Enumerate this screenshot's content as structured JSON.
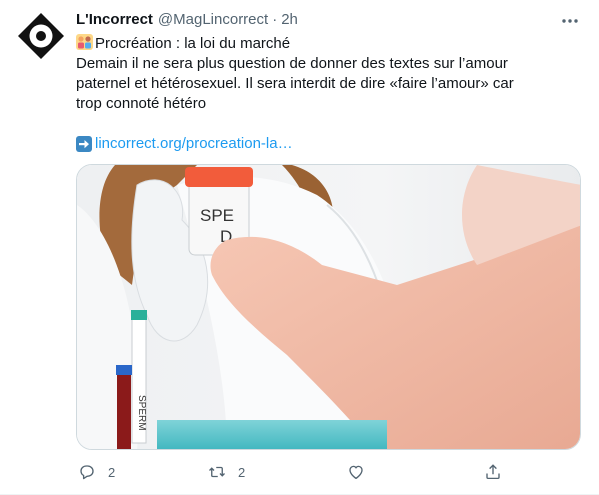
{
  "tweet": {
    "author_name": "L'Incorrect",
    "author_handle": "@MagLincorrect",
    "separator": "·",
    "time": "2h",
    "text_line1": "Procréation : la loi du marché",
    "text_line2": "Demain il ne sera plus question de donner des textes sur l’amour",
    "text_line3": "paternel et hétérosexuel. Il sera interdit de dire «faire l’amour» car",
    "text_line4": "trop connoté hétéro",
    "link_text": "lincorrect.org/procreation-la…",
    "media": {
      "tube_label_top": "SPE",
      "tube_label_bottom": "D",
      "vial_label": "SPERM"
    },
    "icons": {
      "avatar": "lincorrect-logo-icon",
      "emoji": "couple-emoji-icon",
      "arrow": "right-arrow-emoji-icon",
      "more": "more-dots-icon"
    }
  },
  "actions": {
    "reply_count": "2",
    "retweet_count": "2",
    "like_count": "",
    "share_label": ""
  },
  "colors": {
    "link": "#1d9bf0",
    "muted": "#536471",
    "text": "#0f1419"
  }
}
